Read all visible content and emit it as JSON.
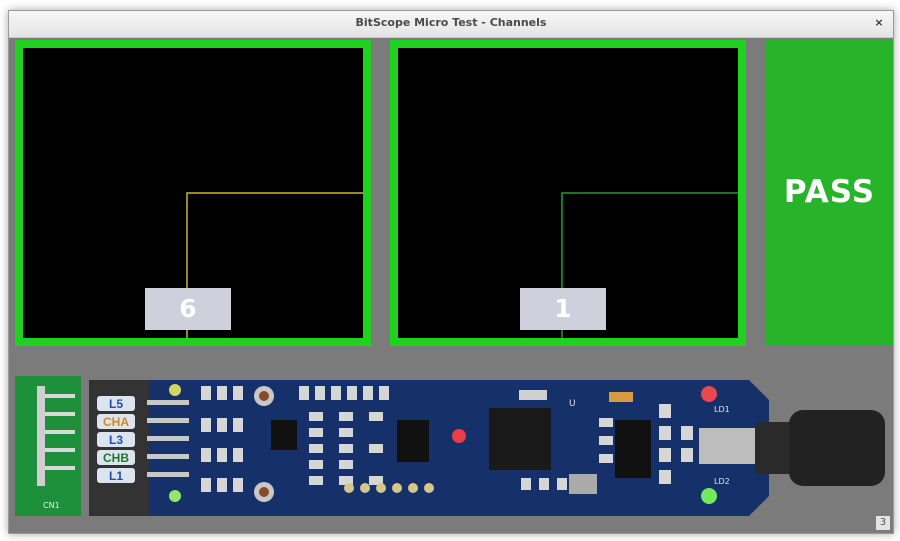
{
  "window": {
    "title": "BitScope Micro Test - Channels",
    "close_glyph": "×"
  },
  "channels": [
    {
      "count": "6",
      "trace_color": "#c9b825"
    },
    {
      "count": "1",
      "trace_color": "#1f9c2f"
    }
  ],
  "result": {
    "label": "PASS",
    "color": "#27b42b"
  },
  "device": {
    "pins": [
      "L5",
      "CHA",
      "L3",
      "CHB",
      "L1"
    ],
    "connector_label": "CN1",
    "led_labels": [
      "LD1",
      "LD2"
    ],
    "ic_label": "U"
  },
  "workspace_badge": "3"
}
